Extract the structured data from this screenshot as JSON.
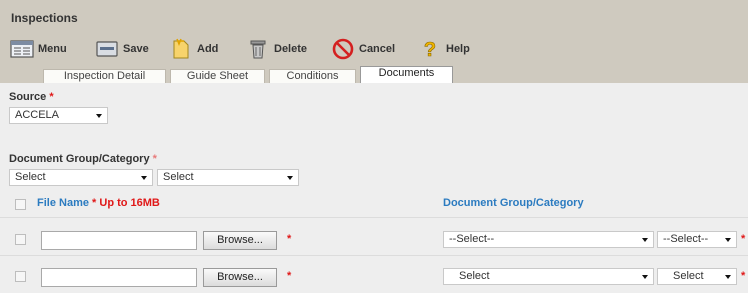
{
  "title": "Inspections",
  "toolbar": {
    "menu": "Menu",
    "save": "Save",
    "add": "Add",
    "delete": "Delete",
    "cancel": "Cancel",
    "help": "Help"
  },
  "tabs": [
    "Inspection Detail",
    "Guide Sheet",
    "Conditions",
    "Documents"
  ],
  "source": {
    "label": "Source",
    "required": "*",
    "value": "ACCELA"
  },
  "docgroup": {
    "label": "Document Group/Category",
    "required": "*",
    "group_value": "Select",
    "category_value": "Select"
  },
  "grid": {
    "file_header": "File Name",
    "file_required": "*",
    "size_note": "Up to 16MB",
    "group_header": "Document Group/Category"
  },
  "rows": [
    {
      "browse": "Browse...",
      "star": "*",
      "group": "--Select--",
      "category": "--Select--",
      "cat_star": "*"
    },
    {
      "browse": "Browse...",
      "star": "*",
      "group": "Select",
      "category": "Select",
      "cat_star": "*"
    }
  ]
}
